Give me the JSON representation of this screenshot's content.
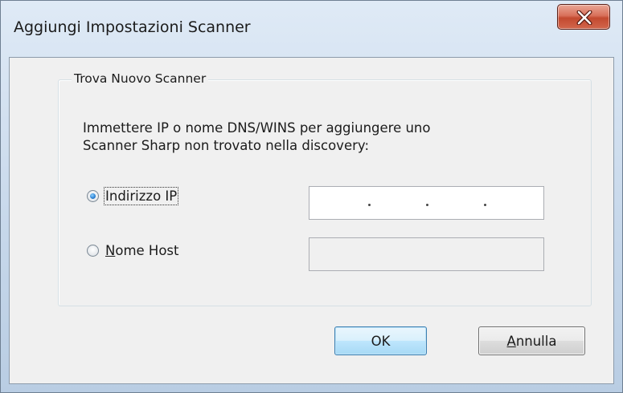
{
  "window": {
    "title": "Aggiungi Impostazioni Scanner"
  },
  "group": {
    "legend": "Trova Nuovo Scanner",
    "description_line1": "Immettere IP o nome DNS/WINS per aggiungere uno",
    "description_line2": "Scanner Sharp non trovato nella discovery:"
  },
  "ip_option": {
    "label": "Indirizzo IP",
    "checked": true,
    "value": "",
    "separator": "."
  },
  "host_option": {
    "label": "Nome Host",
    "checked": false,
    "value": ""
  },
  "buttons": {
    "ok": "OK",
    "cancel": "Annulla"
  },
  "icons": {
    "close": "close-icon"
  },
  "colors": {
    "close_button": "#c94a30",
    "default_button_border": "#3c7fb1",
    "radio_checked": "#2a7fd1"
  }
}
